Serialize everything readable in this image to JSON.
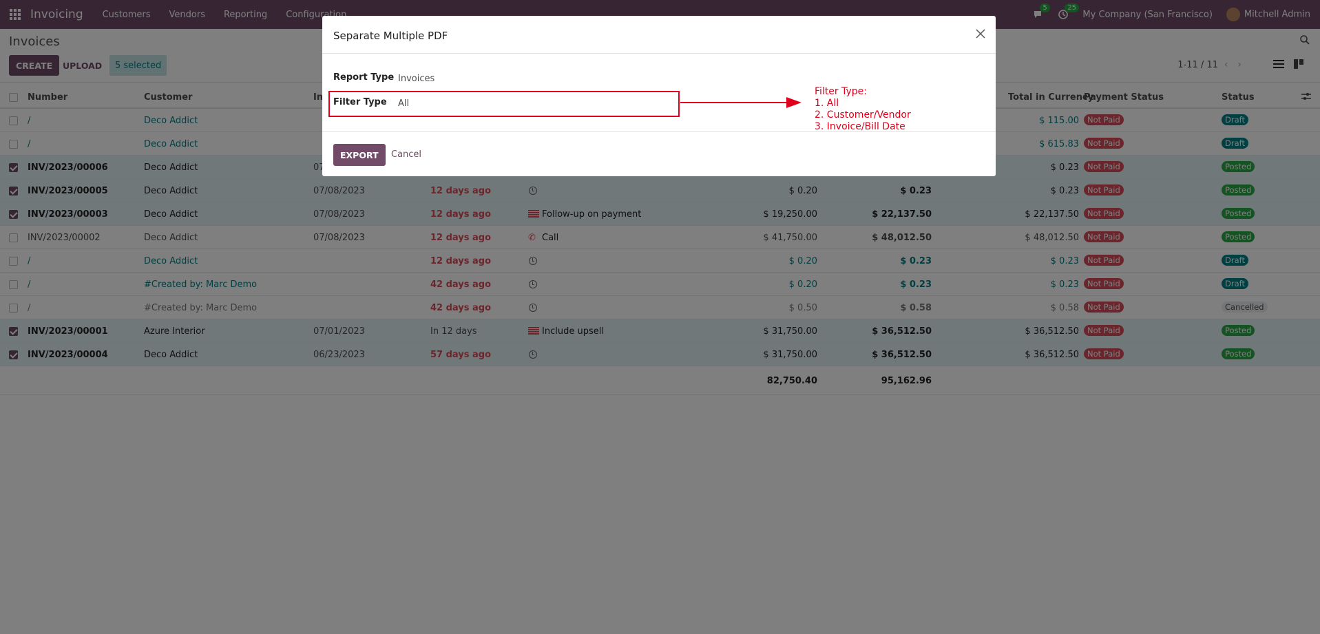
{
  "navbar": {
    "brand": "Invoicing",
    "menu": [
      "Customers",
      "Vendors",
      "Reporting",
      "Configuration"
    ],
    "messages_count": "5",
    "activities_count": "25",
    "company": "My Company (San Francisco)",
    "user": "Mitchell Admin"
  },
  "control_panel": {
    "title": "Invoices",
    "create_label": "CREATE",
    "upload_label": "UPLOAD",
    "selected_label": "5 selected",
    "pager": "1-11 / 11"
  },
  "table": {
    "headers": {
      "number": "Number",
      "customer": "Customer",
      "invoice_date": "In",
      "total_currency": "Total in Currency",
      "payment_status": "Payment Status",
      "status": "Status"
    },
    "rows": [
      {
        "number": "/",
        "customer": "Deco Addict",
        "date": "",
        "due": "",
        "activity": "",
        "untaxed": "",
        "total": "",
        "currency": "$ 115.00",
        "payment": "Not Paid",
        "status": "Draft"
      },
      {
        "number": "/",
        "customer": "Deco Addict",
        "date": "",
        "due": "",
        "activity": "",
        "untaxed": "",
        "total": "",
        "currency": "$ 615.83",
        "payment": "Not Paid",
        "status": "Draft"
      },
      {
        "number": "INV/2023/00006",
        "customer": "Deco Addict",
        "date": "07",
        "due": "",
        "activity": "",
        "untaxed": "",
        "total": "",
        "currency": "$ 0.23",
        "payment": "Not Paid",
        "status": "Posted"
      },
      {
        "number": "INV/2023/00005",
        "customer": "Deco Addict",
        "date": "07/08/2023",
        "due": "12 days ago",
        "activity": "",
        "untaxed": "$ 0.20",
        "total": "$ 0.23",
        "currency": "$ 0.23",
        "payment": "Not Paid",
        "status": "Posted"
      },
      {
        "number": "INV/2023/00003",
        "customer": "Deco Addict",
        "date": "07/08/2023",
        "due": "12 days ago",
        "activity": "Follow-up on payment",
        "untaxed": "$ 19,250.00",
        "total": "$ 22,137.50",
        "currency": "$ 22,137.50",
        "payment": "Not Paid",
        "status": "Posted"
      },
      {
        "number": "INV/2023/00002",
        "customer": "Deco Addict",
        "date": "07/08/2023",
        "due": "12 days ago",
        "activity": "Call",
        "untaxed": "$ 41,750.00",
        "total": "$ 48,012.50",
        "currency": "$ 48,012.50",
        "payment": "Not Paid",
        "status": "Posted"
      },
      {
        "number": "/",
        "customer": "Deco Addict",
        "date": "",
        "due": "12 days ago",
        "activity": "",
        "untaxed": "$ 0.20",
        "total": "$ 0.23",
        "currency": "$ 0.23",
        "payment": "Not Paid",
        "status": "Draft"
      },
      {
        "number": "/",
        "customer": "#Created by: Marc Demo",
        "date": "",
        "due": "42 days ago",
        "activity": "",
        "untaxed": "$ 0.20",
        "total": "$ 0.23",
        "currency": "$ 0.23",
        "payment": "Not Paid",
        "status": "Draft"
      },
      {
        "number": "/",
        "customer": "#Created by: Marc Demo",
        "date": "",
        "due": "42 days ago",
        "activity": "",
        "untaxed": "$ 0.50",
        "total": "$ 0.58",
        "currency": "$ 0.58",
        "payment": "Not Paid",
        "status": "Cancelled"
      },
      {
        "number": "INV/2023/00001",
        "customer": "Azure Interior",
        "date": "07/01/2023",
        "due": "In 12 days",
        "activity": "Include upsell",
        "untaxed": "$ 31,750.00",
        "total": "$ 36,512.50",
        "currency": "$ 36,512.50",
        "payment": "Not Paid",
        "status": "Posted"
      },
      {
        "number": "INV/2023/00004",
        "customer": "Deco Addict",
        "date": "06/23/2023",
        "due": "57 days ago",
        "activity": "",
        "untaxed": "$ 31,750.00",
        "total": "$ 36,512.50",
        "currency": "$ 36,512.50",
        "payment": "Not Paid",
        "status": "Posted"
      }
    ],
    "totals": {
      "untaxed": "82,750.40",
      "total": "95,162.96"
    }
  },
  "dialog": {
    "title": "Separate Multiple PDF",
    "report_type_label": "Report Type",
    "report_type_value": "Invoices",
    "filter_type_label": "Filter Type",
    "filter_type_value": "All",
    "export_label": "EXPORT",
    "cancel_label": "Cancel"
  },
  "annotation": {
    "heading": "Filter Type:",
    "lines": [
      "1. All",
      "2. Customer/Vendor",
      "3. Invoice/Bill Date"
    ]
  }
}
